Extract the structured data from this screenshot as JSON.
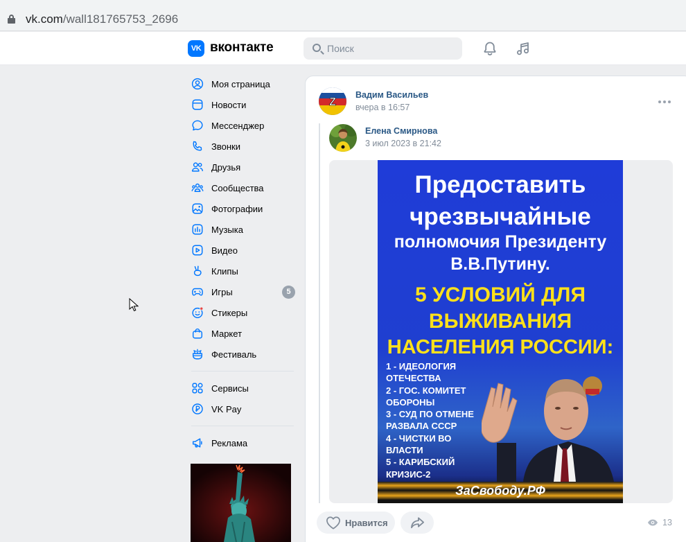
{
  "browser": {
    "url_domain": "vk.com",
    "url_path": "/wall181765753_2696"
  },
  "header": {
    "logo_text": "VK",
    "brand_name": "вконтакте",
    "search_placeholder": "Поиск",
    "icons": [
      "bell-icon",
      "music-note-icon"
    ]
  },
  "sidebar": {
    "items": [
      {
        "label": "Моя страница",
        "icon": "user-circle-icon"
      },
      {
        "label": "Новости",
        "icon": "news-icon"
      },
      {
        "label": "Мессенджер",
        "icon": "message-bubble-icon"
      },
      {
        "label": "Звонки",
        "icon": "phone-icon"
      },
      {
        "label": "Друзья",
        "icon": "friends-icon"
      },
      {
        "label": "Сообщества",
        "icon": "communities-icon"
      },
      {
        "label": "Фотографии",
        "icon": "photo-icon"
      },
      {
        "label": "Музыка",
        "icon": "music-icon"
      },
      {
        "label": "Видео",
        "icon": "video-icon"
      },
      {
        "label": "Клипы",
        "icon": "clips-icon"
      },
      {
        "label": "Игры",
        "icon": "gamepad-icon",
        "badge": "5"
      },
      {
        "label": "Стикеры",
        "icon": "sticker-icon"
      },
      {
        "label": "Маркет",
        "icon": "bag-icon"
      },
      {
        "label": "Фестиваль",
        "icon": "festival-icon"
      }
    ],
    "secondary": [
      {
        "label": "Сервисы",
        "icon": "services-icon"
      },
      {
        "label": "VK Pay",
        "icon": "vkpay-icon"
      }
    ],
    "ads": [
      {
        "label": "Реклама",
        "icon": "megaphone-icon"
      }
    ]
  },
  "post": {
    "author": "Вадим Васильев",
    "date": "вчера в 16:57",
    "repost": {
      "author": "Елена Смирнова",
      "date": "3 июл 2023 в 21:42"
    },
    "image_text": {
      "line1": "Предоставить",
      "line2": "чрезвычайные",
      "line3": "полномочия Президенту",
      "line4": "В.В.Путину.",
      "line5": "5 УСЛОВИЙ ДЛЯ",
      "line6": "ВЫЖИВАНИЯ",
      "line7": "НАСЕЛЕНИЯ РОССИИ:",
      "list": "1 - ИДЕОЛОГИЯ\nОТЕЧЕСТВА\n2 - ГОС. КОМИТЕТ\nОБОРОНЫ\n3 - СУД ПО ОТМЕНЕ\nРАЗВАЛА СССР\n4 - ЧИСТКИ ВО\nВЛАСТИ\n5 - КАРИБСКИЙ\nКРИЗИС-2",
      "footer": "ЗаСвободу.РФ"
    },
    "like_label": "Нравится",
    "views": "13"
  },
  "colors": {
    "accent": "#0077ff",
    "link": "#2a5885",
    "muted": "#818c99",
    "page_bg": "#edeef0"
  }
}
